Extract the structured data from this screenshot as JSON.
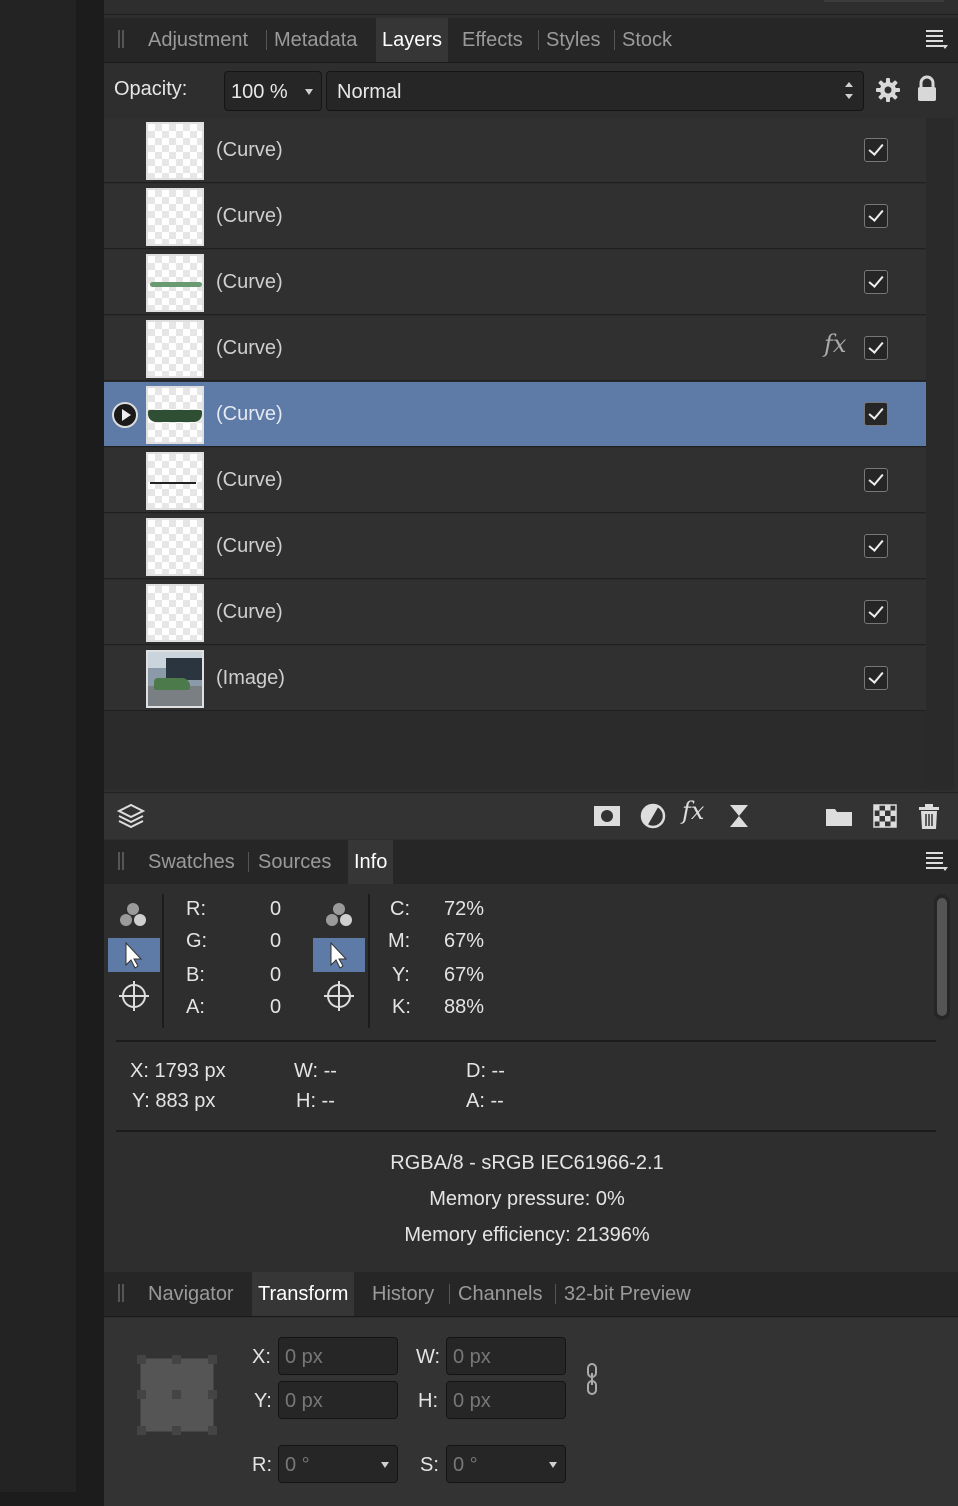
{
  "studio": {
    "tabs": [
      "Adjustment",
      "Metadata",
      "Layers",
      "Effects",
      "Styles",
      "Stock"
    ],
    "active_tab": "Layers"
  },
  "layer_controls": {
    "opacity_label": "Opacity:",
    "opacity_value": "100 %",
    "blend_mode": "Normal"
  },
  "layers": [
    {
      "name": "(Curve)",
      "visible": true,
      "selected": false,
      "fx": false,
      "thumb": "empty"
    },
    {
      "name": "(Curve)",
      "visible": true,
      "selected": false,
      "fx": false,
      "thumb": "empty"
    },
    {
      "name": "(Curve)",
      "visible": true,
      "selected": false,
      "fx": false,
      "thumb": "green-stroke"
    },
    {
      "name": "(Curve)",
      "visible": true,
      "selected": false,
      "fx": true,
      "thumb": "empty"
    },
    {
      "name": "(Curve)",
      "visible": true,
      "selected": true,
      "fx": false,
      "thumb": "dark-green-shape"
    },
    {
      "name": "(Curve)",
      "visible": true,
      "selected": false,
      "fx": false,
      "thumb": "thin-line"
    },
    {
      "name": "(Curve)",
      "visible": true,
      "selected": false,
      "fx": false,
      "thumb": "empty"
    },
    {
      "name": "(Curve)",
      "visible": true,
      "selected": false,
      "fx": false,
      "thumb": "empty"
    },
    {
      "name": "(Image)",
      "visible": true,
      "selected": false,
      "fx": false,
      "thumb": "photo"
    }
  ],
  "fx_glyph": "fx",
  "info_tabs": {
    "tabs": [
      "Swatches",
      "Sources",
      "Info"
    ],
    "active_tab": "Info"
  },
  "info": {
    "rgba": [
      {
        "label": "R:",
        "value": "0"
      },
      {
        "label": "G:",
        "value": "0"
      },
      {
        "label": "B:",
        "value": "0"
      },
      {
        "label": "A:",
        "value": "0"
      }
    ],
    "cmyk": [
      {
        "label": "C:",
        "value": "72%"
      },
      {
        "label": "M:",
        "value": "67%"
      },
      {
        "label": "Y:",
        "value": "67%"
      },
      {
        "label": "K:",
        "value": "88%"
      }
    ],
    "x": "X: 1793 px",
    "y": "Y: 883 px",
    "w": "W: --",
    "h": "H: --",
    "d": "D: --",
    "a": "A: --",
    "color_profile": "RGBA/8 - sRGB IEC61966-2.1",
    "memory_pressure": "Memory pressure: 0%",
    "memory_efficiency": "Memory efficiency: 21396%"
  },
  "transform_tabs": {
    "tabs": [
      "Navigator",
      "Transform",
      "History",
      "Channels",
      "32-bit Preview"
    ],
    "active_tab": "Transform"
  },
  "transform": {
    "x_label": "X:",
    "x_value": "0 px",
    "y_label": "Y:",
    "y_value": "0 px",
    "w_label": "W:",
    "w_value": "0 px",
    "h_label": "H:",
    "h_value": "0 px",
    "r_label": "R:",
    "r_value": "0 °",
    "s_label": "S:",
    "s_value": "0 °"
  },
  "colors": {
    "selection": "#5e7aa6",
    "panel": "#2e2e2e",
    "text": "#d6d6d6"
  }
}
